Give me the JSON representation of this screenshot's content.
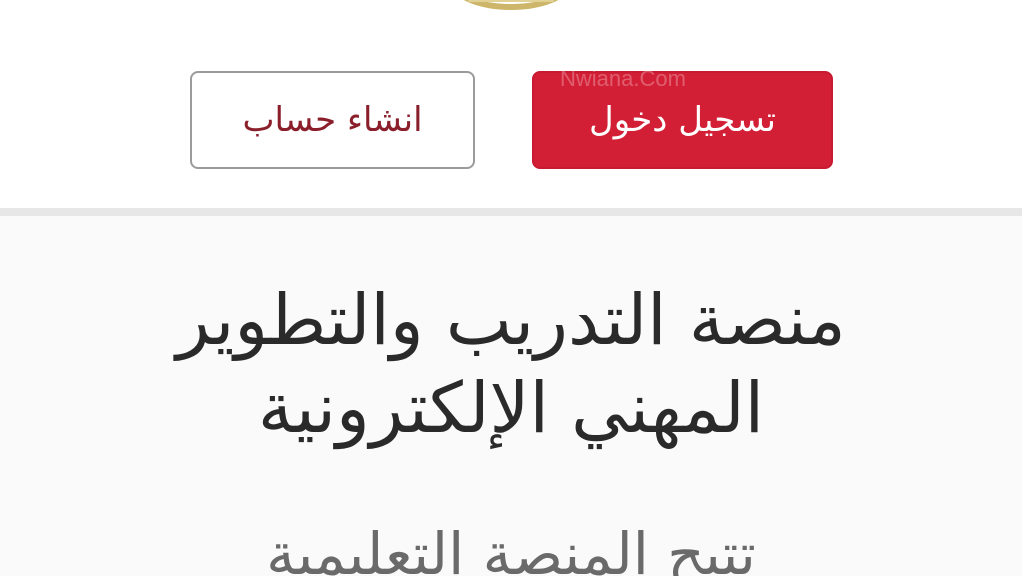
{
  "header": {
    "logo": "logo-emblem",
    "buttons": {
      "login_label": "تسجيل دخول",
      "register_label": "انشاء حساب"
    },
    "watermark": "Nwiana.Com"
  },
  "content": {
    "title_line1": "منصة التدريب والتطوير",
    "title_line2": "المهني الإلكترونية",
    "subtitle": "تتيح المنصة التعليمية"
  },
  "colors": {
    "login_button": "#d31f35",
    "register_text": "#8a1f2b",
    "register_border": "#9b9b9b",
    "divider": "#e7e7e7",
    "title_text": "#2a2a2a",
    "subtitle_text": "#6a6a6a",
    "logo_gold": "#cdb66a"
  }
}
